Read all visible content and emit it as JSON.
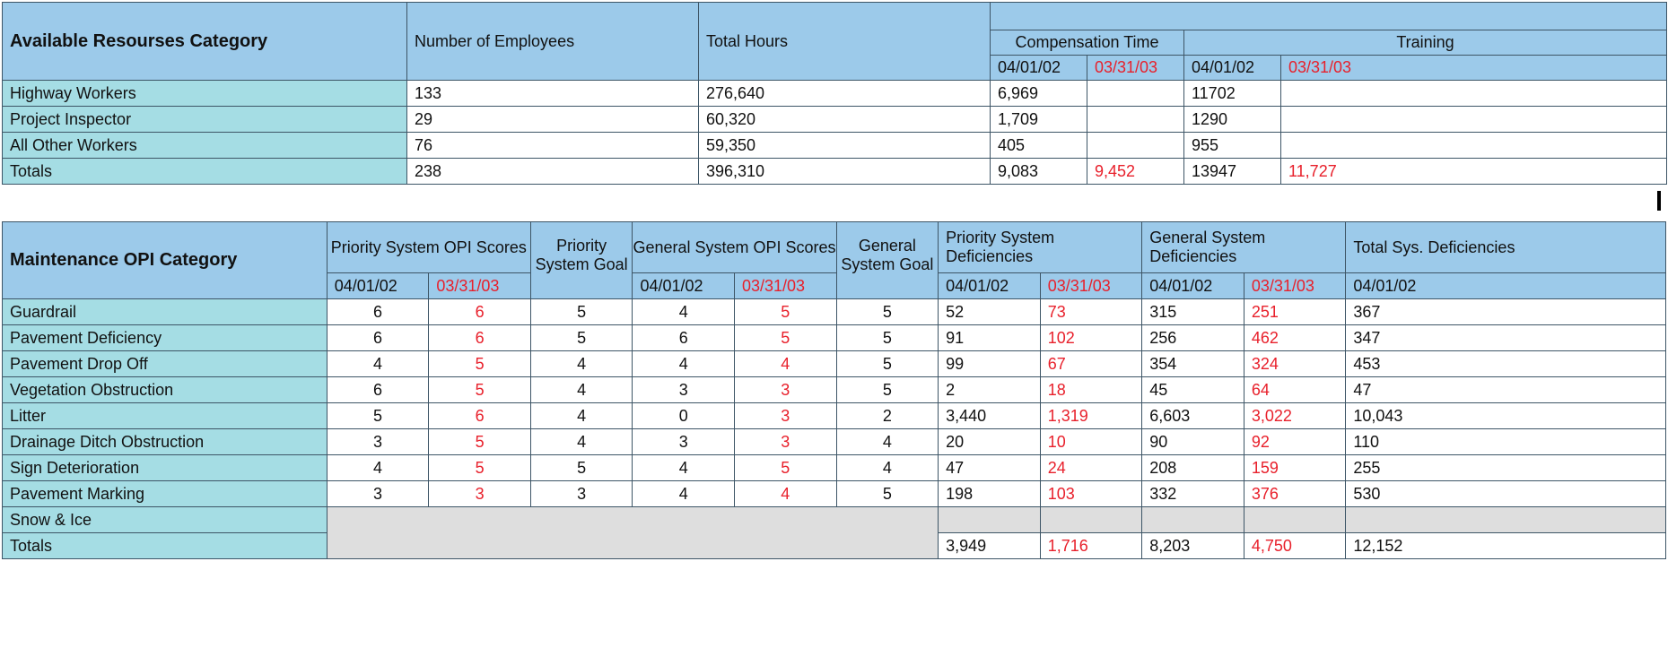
{
  "resources": {
    "headers": {
      "category": "Available Resourses Category",
      "employees": "Number of Employees",
      "hours": "Total Hours",
      "comp_time": "Compensation Time",
      "training": "Training",
      "date_a": "04/01/02",
      "date_b": "03/31/03"
    },
    "rows": [
      {
        "category": "Highway Workers",
        "employees": "133",
        "hours": "276,640",
        "comp_a": "6,969",
        "comp_b": "",
        "train_a": "11702",
        "train_b": ""
      },
      {
        "category": "Project Inspector",
        "employees": "29",
        "hours": "60,320",
        "comp_a": "1,709",
        "comp_b": "",
        "train_a": "1290",
        "train_b": ""
      },
      {
        "category": "All Other Workers",
        "employees": "76",
        "hours": "59,350",
        "comp_a": "405",
        "comp_b": "",
        "train_a": "955",
        "train_b": ""
      },
      {
        "category": "Totals",
        "employees": "238",
        "hours": "396,310",
        "comp_a": "9,083",
        "comp_b": "9,452",
        "train_a": "13947",
        "train_b": "11,727"
      }
    ]
  },
  "opi": {
    "headers": {
      "category": "Maintenance OPI Category",
      "priority_scores": "Priority System OPI Scores",
      "priority_goal": "Priority System Goal",
      "general_scores": "General System OPI Scores",
      "general_goal": "General System Goal",
      "priority_def": "Priority System Deficiencies",
      "general_def": "General System Deficiencies",
      "total_def": "Total Sys. Deficiencies",
      "date_a": "04/01/02",
      "date_b": "03/31/03"
    },
    "rows": [
      {
        "category": "Guardrail",
        "ps_a": "6",
        "ps_b": "6",
        "pgoal": "5",
        "gs_a": "4",
        "gs_b": "5",
        "ggoal": "5",
        "pd_a": "52",
        "pd_b": "73",
        "gd_a": "315",
        "gd_b": "251",
        "td_a": "367"
      },
      {
        "category": "Pavement Deficiency",
        "ps_a": "6",
        "ps_b": "6",
        "pgoal": "5",
        "gs_a": "6",
        "gs_b": "5",
        "ggoal": "5",
        "pd_a": "91",
        "pd_b": "102",
        "gd_a": "256",
        "gd_b": "462",
        "td_a": "347"
      },
      {
        "category": "Pavement Drop Off",
        "ps_a": "4",
        "ps_b": "5",
        "pgoal": "4",
        "gs_a": "4",
        "gs_b": "4",
        "ggoal": "5",
        "pd_a": "99",
        "pd_b": "67",
        "gd_a": "354",
        "gd_b": "324",
        "td_a": "453"
      },
      {
        "category": "Vegetation Obstruction",
        "ps_a": "6",
        "ps_b": "5",
        "pgoal": "4",
        "gs_a": "3",
        "gs_b": "3",
        "ggoal": "5",
        "pd_a": "2",
        "pd_b": "18",
        "gd_a": "45",
        "gd_b": "64",
        "td_a": "47"
      },
      {
        "category": "Litter",
        "ps_a": "5",
        "ps_b": "6",
        "pgoal": "4",
        "gs_a": "0",
        "gs_b": "3",
        "ggoal": "2",
        "pd_a": "3,440",
        "pd_b": "1,319",
        "gd_a": "6,603",
        "gd_b": "3,022",
        "td_a": "10,043"
      },
      {
        "category": "Drainage Ditch Obstruction",
        "ps_a": "3",
        "ps_b": "5",
        "pgoal": "4",
        "gs_a": "3",
        "gs_b": "3",
        "ggoal": "4",
        "pd_a": "20",
        "pd_b": "10",
        "gd_a": "90",
        "gd_b": "92",
        "td_a": "110"
      },
      {
        "category": "Sign Deterioration",
        "ps_a": "4",
        "ps_b": "5",
        "pgoal": "5",
        "gs_a": "4",
        "gs_b": "5",
        "ggoal": "4",
        "pd_a": "47",
        "pd_b": "24",
        "gd_a": "208",
        "gd_b": "159",
        "td_a": "255"
      },
      {
        "category": "Pavement Marking",
        "ps_a": "3",
        "ps_b": "3",
        "pgoal": "3",
        "gs_a": "4",
        "gs_b": "4",
        "ggoal": "5",
        "pd_a": "198",
        "pd_b": "103",
        "gd_a": "332",
        "gd_b": "376",
        "td_a": "530"
      }
    ],
    "snow": {
      "category": "Snow & Ice"
    },
    "totals": {
      "category": "Totals",
      "pd_a": "3,949",
      "pd_b": "1,716",
      "gd_a": "8,203",
      "gd_b": "4,750",
      "td_a": "12,152"
    }
  }
}
